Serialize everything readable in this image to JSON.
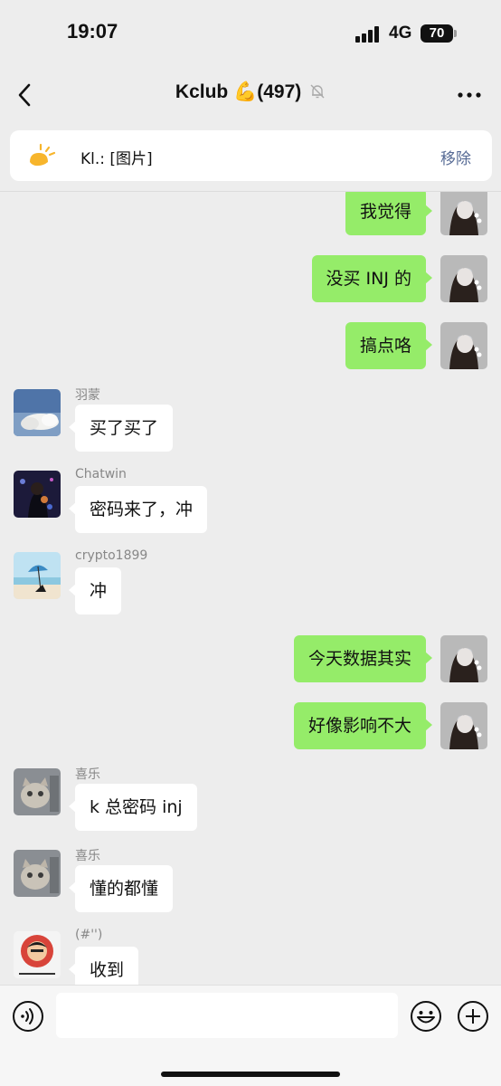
{
  "status_bar": {
    "time": "19:07",
    "network": "4G",
    "battery": "70"
  },
  "header": {
    "title": "Kclub 💪(497)"
  },
  "pinned": {
    "text": "Kl.: [图片]",
    "remove_label": "移除"
  },
  "messages": [
    {
      "side": "mine",
      "text": "我觉得"
    },
    {
      "side": "mine",
      "text": "没买 INJ 的"
    },
    {
      "side": "mine",
      "text": "搞点咯"
    },
    {
      "side": "theirs",
      "sender": "羽蒙",
      "text": "买了买了"
    },
    {
      "side": "theirs",
      "sender": "Chatwin",
      "text": "密码来了，冲"
    },
    {
      "side": "theirs",
      "sender": "crypto1899",
      "text": "冲"
    },
    {
      "side": "mine",
      "text": "今天数据其实"
    },
    {
      "side": "mine",
      "text": "好像影响不大"
    },
    {
      "side": "theirs",
      "sender": "喜乐",
      "text": "k 总密码 inj"
    },
    {
      "side": "theirs",
      "sender": "喜乐",
      "text": "懂的都懂"
    },
    {
      "side": "theirs",
      "sender": "(#'')",
      "text": "收到"
    }
  ],
  "input": {
    "placeholder": ""
  },
  "icons": {
    "back": "chevron-left-icon",
    "more": "more-dots-icon",
    "mute": "bell-muted-icon",
    "pinned": "pinned-sun-icon",
    "voice": "voice-icon",
    "emoji": "emoji-icon",
    "plus": "plus-icon"
  },
  "colors": {
    "my_bubble": "#95ec69",
    "their_bubble": "#ffffff",
    "link": "#576b95",
    "background": "#ededed"
  }
}
